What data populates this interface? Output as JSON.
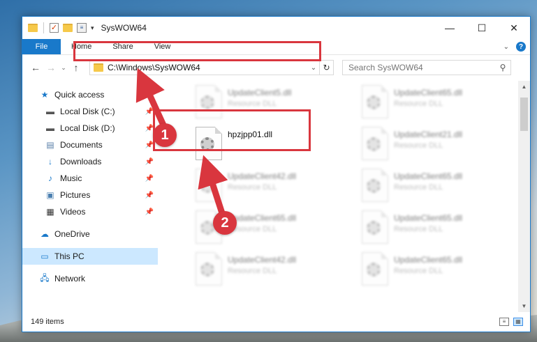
{
  "window": {
    "title": "SysWOW64",
    "controls": {
      "minimize": "—",
      "maximize": "☐",
      "close": "✕"
    }
  },
  "ribbon": {
    "file_tab": "File",
    "tabs": [
      "Home",
      "Share",
      "View"
    ]
  },
  "address": {
    "path": "C:\\Windows\\SysWOW64",
    "search_placeholder": "Search SysWOW64"
  },
  "sidebar": {
    "quick_access": "Quick access",
    "quick_items": [
      {
        "label": "Local Disk (C:)",
        "icon": "drive-icon"
      },
      {
        "label": "Local Disk (D:)",
        "icon": "drive-icon"
      },
      {
        "label": "Documents",
        "icon": "documents-icon"
      },
      {
        "label": "Downloads",
        "icon": "downloads-icon"
      },
      {
        "label": "Music",
        "icon": "music-icon"
      },
      {
        "label": "Pictures",
        "icon": "pictures-icon"
      },
      {
        "label": "Videos",
        "icon": "videos-icon"
      }
    ],
    "onedrive": "OneDrive",
    "this_pc": "This PC",
    "network": "Network"
  },
  "files": [
    {
      "name": "UpdateClient5.dll",
      "type": "Resource DLL",
      "blurred": true
    },
    {
      "name": "UpdateClient65.dll",
      "type": "Resource DLL",
      "blurred": true
    },
    {
      "name": "hpzjpp01.dll",
      "type": "",
      "blurred": false
    },
    {
      "name": "UpdateClient21.dll",
      "type": "Resource DLL",
      "blurred": true
    },
    {
      "name": "UpdateClient42.dll",
      "type": "Resource DLL",
      "blurred": true
    },
    {
      "name": "UpdateClient65.dll",
      "type": "Resource DLL",
      "blurred": true
    },
    {
      "name": "UpdateClient65.dll",
      "type": "Resource DLL",
      "blurred": true
    },
    {
      "name": "UpdateClient65.dll",
      "type": "Resource DLL",
      "blurred": true
    },
    {
      "name": "UpdateClient42.dll",
      "type": "Resource DLL",
      "blurred": true
    },
    {
      "name": "UpdateClient65.dll",
      "type": "Resource DLL",
      "blurred": true
    }
  ],
  "status": {
    "item_count": "149 items"
  },
  "annotations": {
    "step1": "1",
    "step2": "2"
  },
  "colors": {
    "accent": "#1979ca",
    "highlight": "#d9363e",
    "selected": "#cce8ff"
  }
}
